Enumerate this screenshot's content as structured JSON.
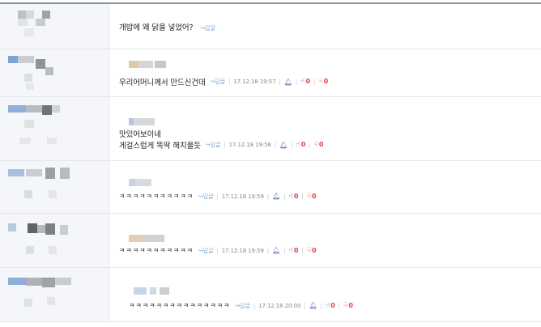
{
  "comments": [
    {
      "nickname": "",
      "lines": [
        "개밥에 왜 닭을 넣었어?"
      ],
      "reply_label": "↪답글",
      "date": "",
      "up": "",
      "down": ""
    },
    {
      "nickname": "",
      "lines": [
        "우리어머니께서 만드신건데"
      ],
      "reply_label": "↪답글",
      "date": "17.12.18 19:57",
      "up": "0",
      "down": "0"
    },
    {
      "nickname": "",
      "lines": [
        "맛있어보이네",
        "게걸스럽게 똑딱 해치울듯"
      ],
      "reply_label": "↪답글",
      "date": "17.12.18 19:58",
      "up": "0",
      "down": "0"
    },
    {
      "nickname": "",
      "lines": [
        "ㅋㅋㅋㅋㅋㅋㅋㅋㅋㅋㅋ"
      ],
      "reply_label": "↪답글",
      "date": "17.12.18 19:59",
      "up": "0",
      "down": "0"
    },
    {
      "nickname": "",
      "lines": [
        "ㅋㅋㅋㅋㅋㅋㅋㅋㅋㅋㅋ"
      ],
      "reply_label": "↪답글",
      "date": "17.12.18 19:59",
      "up": "0",
      "down": "0"
    },
    {
      "nickname": "",
      "lines": [
        "ㅋㅋㅋㅋㅋㅋㅋㅋㅋㅋㅋㅋㅋㅋㅋ"
      ],
      "reply_label": "↪답글",
      "date": "17.12.18 20:00",
      "up": "0",
      "down": "0"
    }
  ],
  "icons": {
    "alarm": "bell-icon",
    "upvote": "thumbs-up-icon",
    "downvote": "thumbs-down-icon",
    "reply": "reply-arrow-icon"
  },
  "colors": {
    "reply_link": "#7fa6d9",
    "vote_count": "#e04444",
    "icon_blue": "#4b6eaf",
    "avatar_bg": "#f4f6f9"
  }
}
